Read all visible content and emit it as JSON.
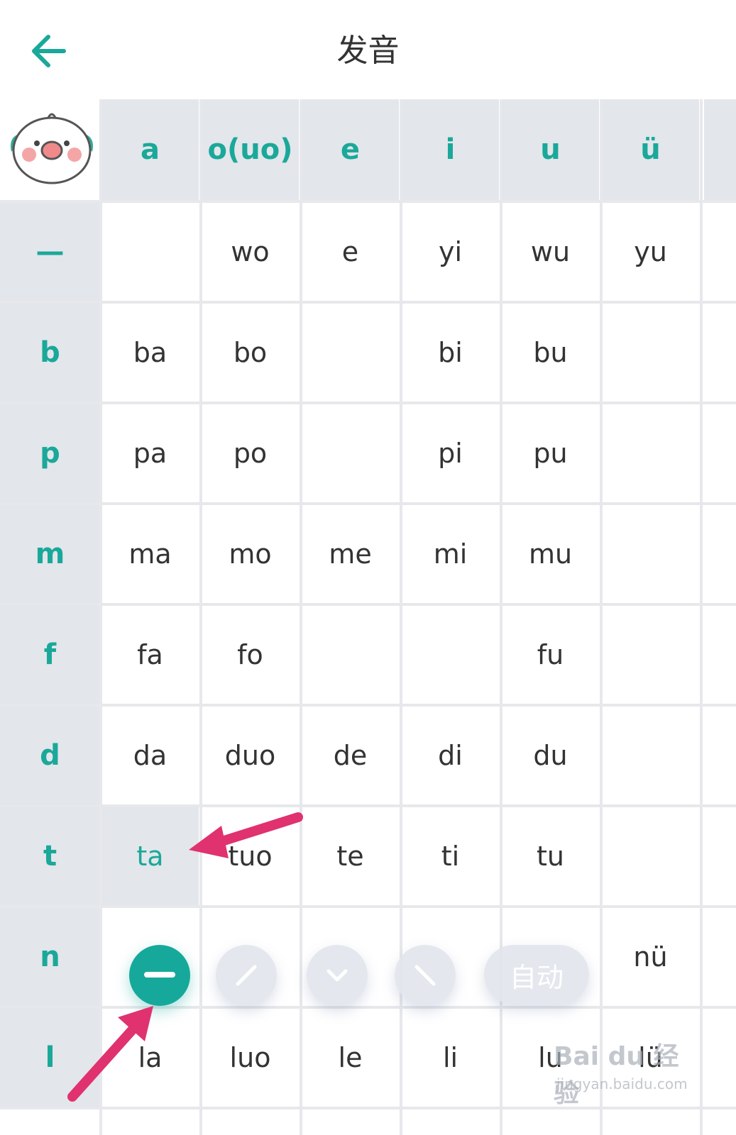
{
  "header": {
    "title": "发音"
  },
  "columns": [
    "a",
    "o(uo)",
    "e",
    "i",
    "u",
    "ü"
  ],
  "rows": [
    {
      "initial": "—",
      "cells": [
        "",
        "wo",
        "e",
        "yi",
        "wu",
        "yu"
      ]
    },
    {
      "initial": "b",
      "cells": [
        "ba",
        "bo",
        "",
        "bi",
        "bu",
        ""
      ]
    },
    {
      "initial": "p",
      "cells": [
        "pa",
        "po",
        "",
        "pi",
        "pu",
        ""
      ]
    },
    {
      "initial": "m",
      "cells": [
        "ma",
        "mo",
        "me",
        "mi",
        "mu",
        ""
      ]
    },
    {
      "initial": "f",
      "cells": [
        "fa",
        "fo",
        "",
        "",
        "fu",
        ""
      ]
    },
    {
      "initial": "d",
      "cells": [
        "da",
        "duo",
        "de",
        "di",
        "du",
        ""
      ]
    },
    {
      "initial": "t",
      "cells": [
        "ta",
        "tuo",
        "te",
        "ti",
        "tu",
        ""
      ]
    },
    {
      "initial": "n",
      "cells": [
        "",
        "",
        "",
        "",
        "",
        "nü"
      ]
    },
    {
      "initial": "l",
      "cells": [
        "la",
        "luo",
        "le",
        "li",
        "lu",
        "lü"
      ]
    }
  ],
  "selected": {
    "row": 6,
    "col": 0
  },
  "tone_bar": {
    "auto_label": "自动",
    "active_tone": 1
  },
  "watermark": {
    "line1": "Bai du 经验",
    "line2": "jingyan.baidu.com"
  },
  "colors": {
    "accent": "#1aa89a",
    "header_bg": "#e3e6ea",
    "arrow": "#e0326f"
  }
}
